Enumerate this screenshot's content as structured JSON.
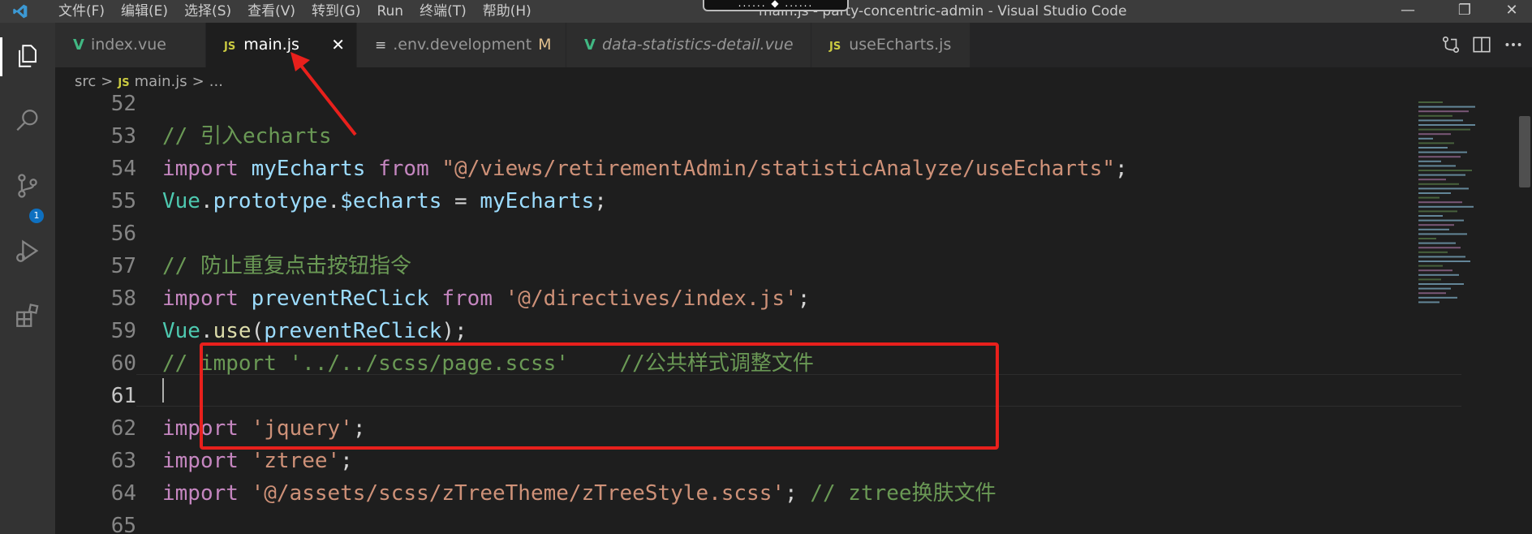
{
  "titlebar": {
    "menu": [
      "文件(F)",
      "编辑(E)",
      "选择(S)",
      "查看(V)",
      "转到(G)",
      "Run",
      "终端(T)",
      "帮助(H)"
    ],
    "window_title": "main.js - party-concentric-admin - Visual Studio Code",
    "notch_text": "...... ◆ ......",
    "controls": {
      "minimize": "—",
      "restore": "❐",
      "close": "✕"
    }
  },
  "activitybar": {
    "icons": [
      "explorer-icon",
      "search-icon",
      "source-control-icon",
      "run-debug-icon",
      "extensions-icon"
    ],
    "source_control_badge": "1"
  },
  "tabs": [
    {
      "icon": "V",
      "label": "index.vue",
      "active": false,
      "italic": false,
      "modified": ""
    },
    {
      "icon": "JS",
      "label": "main.js",
      "active": true,
      "italic": false,
      "modified": ""
    },
    {
      "icon": "≡",
      "label": ".env.development",
      "active": false,
      "italic": false,
      "modified": "M"
    },
    {
      "icon": "V",
      "label": "data-statistics-detail.vue",
      "active": false,
      "italic": true,
      "modified": ""
    },
    {
      "icon": "JS",
      "label": "useEcharts.js",
      "active": false,
      "italic": false,
      "modified": ""
    }
  ],
  "breadcrumb": {
    "folder": "src",
    "file_icon": "JS",
    "file": "main.js",
    "tail": "...",
    "sep": ">"
  },
  "editor": {
    "line_numbers": [
      "52",
      "53",
      "54",
      "55",
      "56",
      "57",
      "58",
      "59",
      "60",
      "61",
      "62",
      "63",
      "64",
      "65"
    ],
    "current_line": "61",
    "lines": [
      [],
      [
        {
          "t": "// 引入echarts",
          "c": "cmt"
        }
      ],
      [
        {
          "t": "import",
          "c": "kw"
        },
        {
          "t": " myEcharts ",
          "c": "var"
        },
        {
          "t": "from",
          "c": "kw"
        },
        {
          "t": " ",
          "c": "txt"
        },
        {
          "t": "\"@/views/retirementAdmin/statisticAnalyze/useEcharts\"",
          "c": "str"
        },
        {
          "t": ";",
          "c": "txt"
        }
      ],
      [
        {
          "t": "Vue",
          "c": "cls"
        },
        {
          "t": ".",
          "c": "txt"
        },
        {
          "t": "prototype",
          "c": "var"
        },
        {
          "t": ".",
          "c": "txt"
        },
        {
          "t": "$echarts",
          "c": "var"
        },
        {
          "t": " = ",
          "c": "txt"
        },
        {
          "t": "myEcharts",
          "c": "var"
        },
        {
          "t": ";",
          "c": "txt"
        }
      ],
      [],
      [
        {
          "t": "// 防止重复点击按钮指令",
          "c": "cmt"
        }
      ],
      [
        {
          "t": "import",
          "c": "kw"
        },
        {
          "t": " preventReClick ",
          "c": "var"
        },
        {
          "t": "from",
          "c": "kw"
        },
        {
          "t": " ",
          "c": "txt"
        },
        {
          "t": "'@/directives/index.js'",
          "c": "str"
        },
        {
          "t": ";",
          "c": "txt"
        }
      ],
      [
        {
          "t": "Vue",
          "c": "cls"
        },
        {
          "t": ".",
          "c": "txt"
        },
        {
          "t": "use",
          "c": "fn"
        },
        {
          "t": "(",
          "c": "txt"
        },
        {
          "t": "preventReClick",
          "c": "var"
        },
        {
          "t": ");",
          "c": "txt"
        }
      ],
      [
        {
          "t": "// import '../../scss/page.scss'    //公共样式调整文件",
          "c": "cmt"
        }
      ],
      [],
      [
        {
          "t": "import",
          "c": "kw"
        },
        {
          "t": " ",
          "c": "txt"
        },
        {
          "t": "'jquery'",
          "c": "str"
        },
        {
          "t": ";",
          "c": "txt"
        }
      ],
      [
        {
          "t": "import",
          "c": "kw"
        },
        {
          "t": " ",
          "c": "txt"
        },
        {
          "t": "'ztree'",
          "c": "str"
        },
        {
          "t": ";",
          "c": "txt"
        }
      ],
      [
        {
          "t": "import",
          "c": "kw"
        },
        {
          "t": " ",
          "c": "txt"
        },
        {
          "t": "'@/assets/scss/zTreeTheme/zTreeStyle.scss'",
          "c": "str"
        },
        {
          "t": "; ",
          "c": "txt"
        },
        {
          "t": "// ztree换肤文件",
          "c": "cmt"
        }
      ],
      []
    ]
  },
  "colors": {
    "keyword": "#c586c0",
    "variable": "#9cdcfe",
    "string": "#ce9178",
    "class": "#4ec9b0",
    "function": "#dcdcaa",
    "comment": "#6a9955",
    "annotation_red": "#e8201c"
  }
}
